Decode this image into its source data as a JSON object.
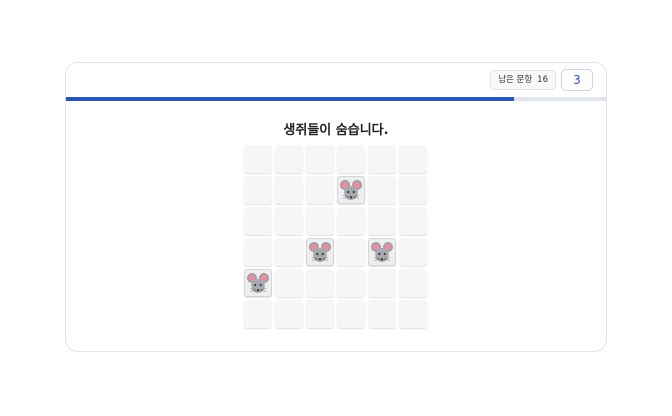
{
  "header": {
    "remaining_label": "남은 문항",
    "remaining_count": "16",
    "answer_value": "3"
  },
  "progress": {
    "fraction": 0.83,
    "color": "#2c56b5"
  },
  "question": {
    "text": "생쥐들이 숨습니다."
  },
  "board": {
    "rows": 6,
    "cols": 6,
    "mice": [
      [
        1,
        3
      ],
      [
        3,
        2
      ],
      [
        3,
        4
      ],
      [
        4,
        0
      ]
    ],
    "icon": "mouse-icon"
  }
}
